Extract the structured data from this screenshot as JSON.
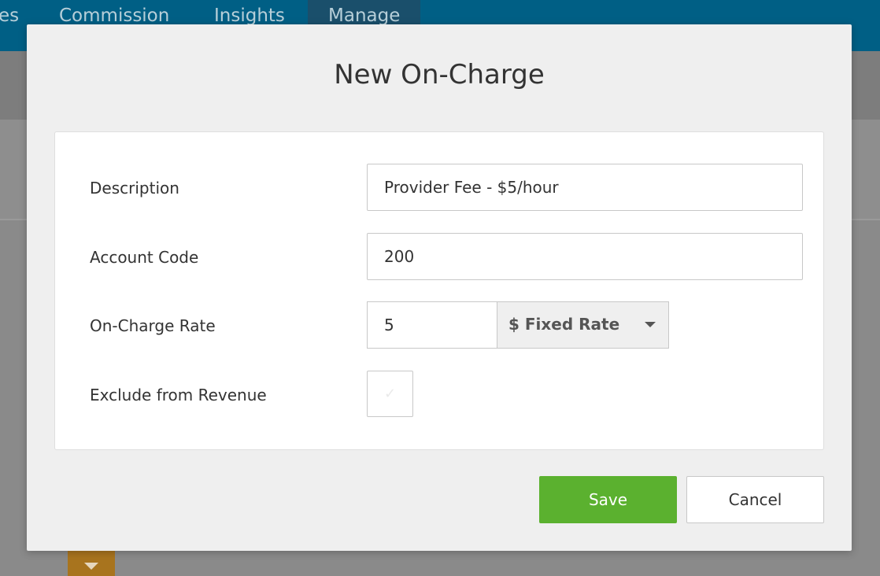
{
  "app_nav": {
    "tabs": [
      {
        "label": "es"
      },
      {
        "label": "Commission"
      },
      {
        "label": "Insights"
      },
      {
        "label": "Manage"
      }
    ]
  },
  "modal": {
    "title": "New On-Charge",
    "fields": {
      "description": {
        "label": "Description",
        "value": "Provider Fee - $5/hour"
      },
      "account_code": {
        "label": "Account Code",
        "value": "200"
      },
      "on_charge_rate": {
        "label": "On-Charge Rate",
        "value": "5",
        "rate_type": "$ Fixed Rate"
      },
      "exclude_from_revenue": {
        "label": "Exclude from Revenue",
        "checked": false
      }
    },
    "buttons": {
      "save": "Save",
      "cancel": "Cancel"
    }
  },
  "colors": {
    "nav_bg": "#005f85",
    "save_green": "#5bb12f"
  }
}
